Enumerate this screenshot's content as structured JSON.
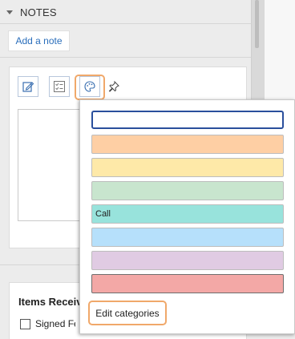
{
  "notes": {
    "header": "NOTES",
    "add_note": "Add a note"
  },
  "toolbar": {
    "buttons": [
      {
        "icon": "edit-note-icon"
      },
      {
        "icon": "checklist-icon"
      },
      {
        "icon": "palette-icon"
      },
      {
        "icon": "pin-icon"
      }
    ]
  },
  "items_section": {
    "title": "Items Received",
    "checkbox_label": "Signed Fee"
  },
  "color_picker": {
    "input_value": "",
    "categories": [
      {
        "label": "",
        "color": "#fecfa4"
      },
      {
        "label": "",
        "color": "#fee9a8"
      },
      {
        "label": "",
        "color": "#c8e5ce"
      },
      {
        "label": "Call",
        "color": "#98e3dc"
      },
      {
        "label": "",
        "color": "#b6e0fb"
      },
      {
        "label": "",
        "color": "#e0cbe3"
      },
      {
        "label": "",
        "color": "#f3a8a6"
      }
    ],
    "edit_categories": "Edit categories"
  },
  "colors": {
    "accent_blue": "#2a4f9c",
    "highlight_orange": "#f0a86a",
    "link_blue": "#2a6ebb"
  }
}
